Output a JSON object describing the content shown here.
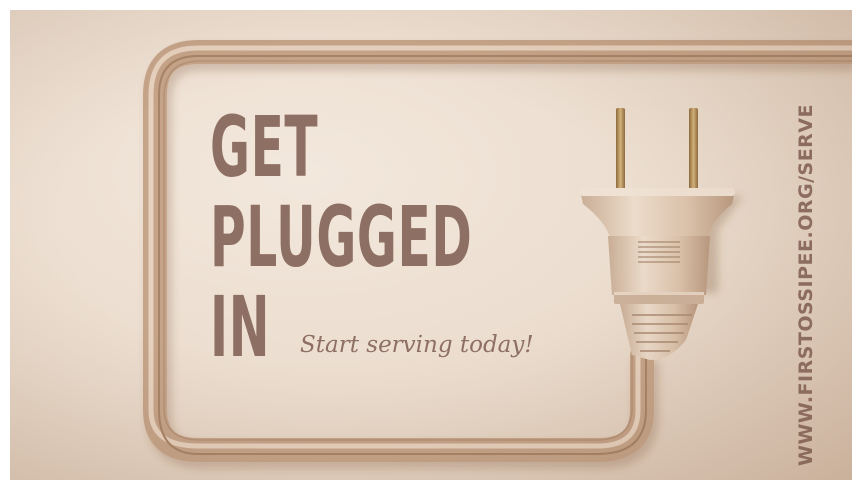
{
  "graphic": {
    "headline_lines": [
      "GET",
      "PLUGGED",
      "IN"
    ],
    "tagline": "Start serving today!",
    "url": "WWW.FIRSTOSSIPEE.ORG/SERVE",
    "icon": "electrical-plug-icon",
    "colors": {
      "background": "#eadbcc",
      "text": "#8e6f63",
      "cord": "#c9a88e",
      "plug_body": "#e2cbb6",
      "prongs": "#b08a55"
    }
  }
}
